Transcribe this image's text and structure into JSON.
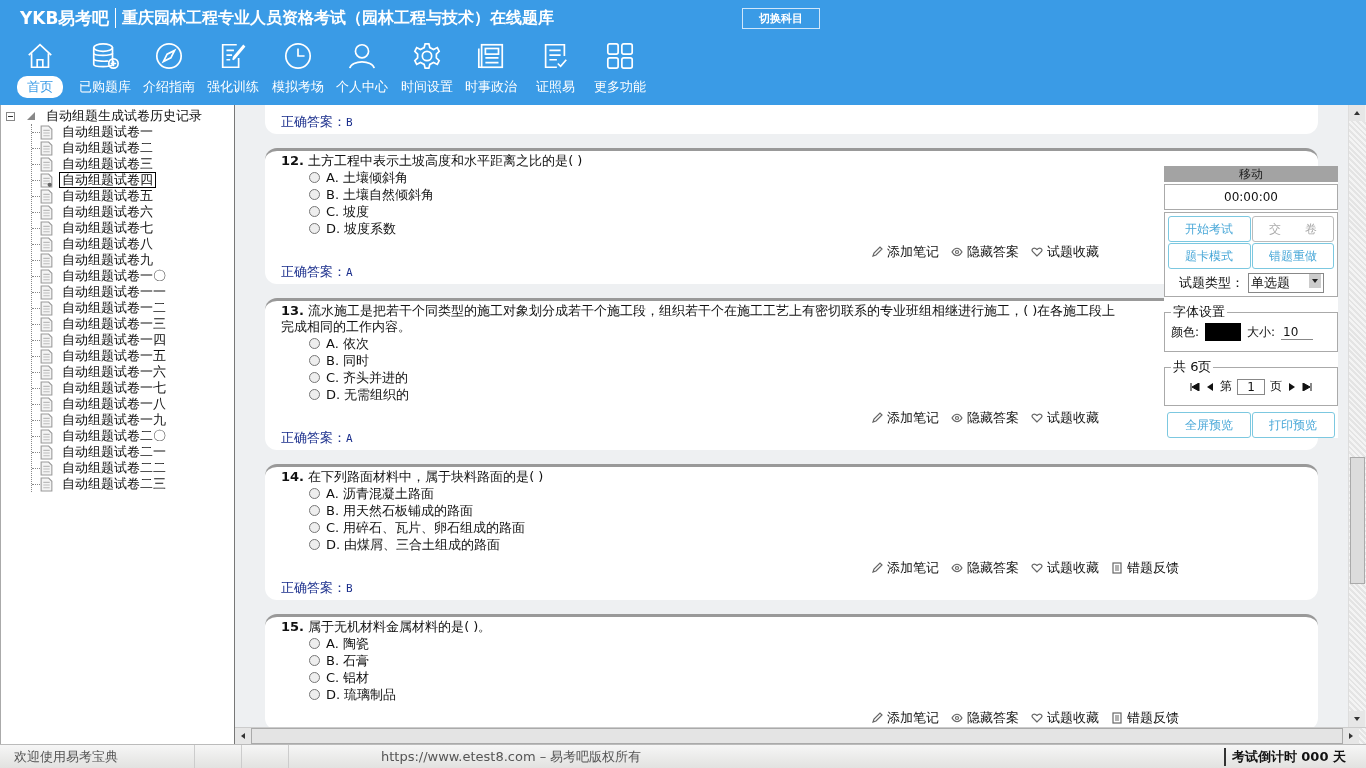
{
  "header": {
    "logo": "YKB易考吧",
    "title": "重庆园林工程专业人员资格考试（园林工程与技术）在线题库",
    "switch_button": "切换科目"
  },
  "nav": [
    {
      "label": "首页",
      "selected": true
    },
    {
      "label": "已购题库",
      "selected": false
    },
    {
      "label": "介绍指南",
      "selected": false
    },
    {
      "label": "强化训练",
      "selected": false
    },
    {
      "label": "模拟考场",
      "selected": false
    },
    {
      "label": "个人中心",
      "selected": false
    },
    {
      "label": "时间设置",
      "selected": false
    },
    {
      "label": "时事政治",
      "selected": false
    },
    {
      "label": "证照易",
      "selected": false
    },
    {
      "label": "更多功能",
      "selected": false
    }
  ],
  "tree": {
    "label": "自动组题生成试卷历史记录",
    "expanded": true,
    "children": [
      {
        "label": "自动组题试卷一",
        "selected": false
      },
      {
        "label": "自动组题试卷二",
        "selected": false
      },
      {
        "label": "自动组题试卷三",
        "selected": false
      },
      {
        "label": "自动组题试卷四",
        "selected": true
      },
      {
        "label": "自动组题试卷五",
        "selected": false
      },
      {
        "label": "自动组题试卷六",
        "selected": false
      },
      {
        "label": "自动组题试卷七",
        "selected": false
      },
      {
        "label": "自动组题试卷八",
        "selected": false
      },
      {
        "label": "自动组题试卷九",
        "selected": false
      },
      {
        "label": "自动组题试卷一〇",
        "selected": false
      },
      {
        "label": "自动组题试卷一一",
        "selected": false
      },
      {
        "label": "自动组题试卷一二",
        "selected": false
      },
      {
        "label": "自动组题试卷一三",
        "selected": false
      },
      {
        "label": "自动组题试卷一四",
        "selected": false
      },
      {
        "label": "自动组题试卷一五",
        "selected": false
      },
      {
        "label": "自动组题试卷一六",
        "selected": false
      },
      {
        "label": "自动组题试卷一七",
        "selected": false
      },
      {
        "label": "自动组题试卷一八",
        "selected": false
      },
      {
        "label": "自动组题试卷一九",
        "selected": false
      },
      {
        "label": "自动组题试卷二〇",
        "selected": false
      },
      {
        "label": "自动组题试卷二一",
        "selected": false
      },
      {
        "label": "自动组题试卷二二",
        "selected": false
      },
      {
        "label": "自动组题试卷二三",
        "selected": false
      }
    ]
  },
  "partial_answer": {
    "label": "正确答案：",
    "value": "B"
  },
  "questions": [
    {
      "number": "12.",
      "text": "土方工程中表示土坡高度和水平距离之比的是( )",
      "options": [
        {
          "label": "A. 土壤倾斜角",
          "selected": false
        },
        {
          "label": "B. 土壤自然倾斜角",
          "selected": false
        },
        {
          "label": "C. 坡度",
          "selected": false
        },
        {
          "label": "D. 坡度系数",
          "selected": false
        }
      ],
      "actions": [
        "添加笔记",
        "隐藏答案",
        "试题收藏"
      ],
      "answer_label": "正确答案：",
      "answer": "A"
    },
    {
      "number": "13.",
      "text": "流水施工是把若干个同类型的施工对象划分成若干个施工段，组织若干个在施工工艺上有密切联系的专业班组相继进行施工，( )在各施工段上完成相同的工作内容。",
      "options": [
        {
          "label": "A. 依次",
          "selected": false
        },
        {
          "label": "B. 同时",
          "selected": false
        },
        {
          "label": "C. 齐头并进的",
          "selected": false
        },
        {
          "label": "D. 无需组织的",
          "selected": false
        }
      ],
      "actions": [
        "添加笔记",
        "隐藏答案",
        "试题收藏"
      ],
      "answer_label": "正确答案：",
      "answer": "A"
    },
    {
      "number": "14.",
      "text": "在下列路面材料中，属于块料路面的是( )",
      "options": [
        {
          "label": "A. 沥青混凝土路面",
          "selected": false
        },
        {
          "label": "B. 用天然石板铺成的路面",
          "selected": false
        },
        {
          "label": "C. 用碎石、瓦片、卵石组成的路面",
          "selected": false
        },
        {
          "label": "D. 由煤屑、三合土组成的路面",
          "selected": false
        }
      ],
      "actions": [
        "添加笔记",
        "隐藏答案",
        "试题收藏",
        "错题反馈"
      ],
      "answer_label": "正确答案：",
      "answer": "B"
    },
    {
      "number": "15.",
      "text": "属于无机材料金属材料的是( )。",
      "options": [
        {
          "label": "A. 陶瓷",
          "selected": false
        },
        {
          "label": "B. 石膏",
          "selected": false
        },
        {
          "label": "C. 铝材",
          "selected": false
        },
        {
          "label": "D. 琉璃制品",
          "selected": false
        }
      ],
      "actions": [
        "添加笔记",
        "隐藏答案",
        "试题收藏",
        "错题反馈"
      ]
    }
  ],
  "panel": {
    "title": "移动",
    "timer": "00:00:00",
    "buttons": [
      {
        "label": "开始考试",
        "disabled": false
      },
      {
        "label": "交　　卷",
        "disabled": true
      },
      {
        "label": "题卡模式",
        "disabled": false
      },
      {
        "label": "错题重做",
        "disabled": false
      }
    ],
    "type_label": "试题类型：",
    "type_value": "单选题",
    "font_group": "字体设置",
    "color_label": "颜色:",
    "color": "#000000",
    "size_label": "大小:",
    "size_value": "10",
    "page_group": "共 6页",
    "page_prefix": "第",
    "page_value": "1",
    "page_suffix": "页",
    "bottom_buttons": [
      "全屏预览",
      "打印预览"
    ]
  },
  "status_bar": {
    "welcome": "欢迎使用易考宝典",
    "copyright": "https://www.etest8.com – 易考吧版权所有",
    "countdown": "考试倒计时 000 天"
  }
}
